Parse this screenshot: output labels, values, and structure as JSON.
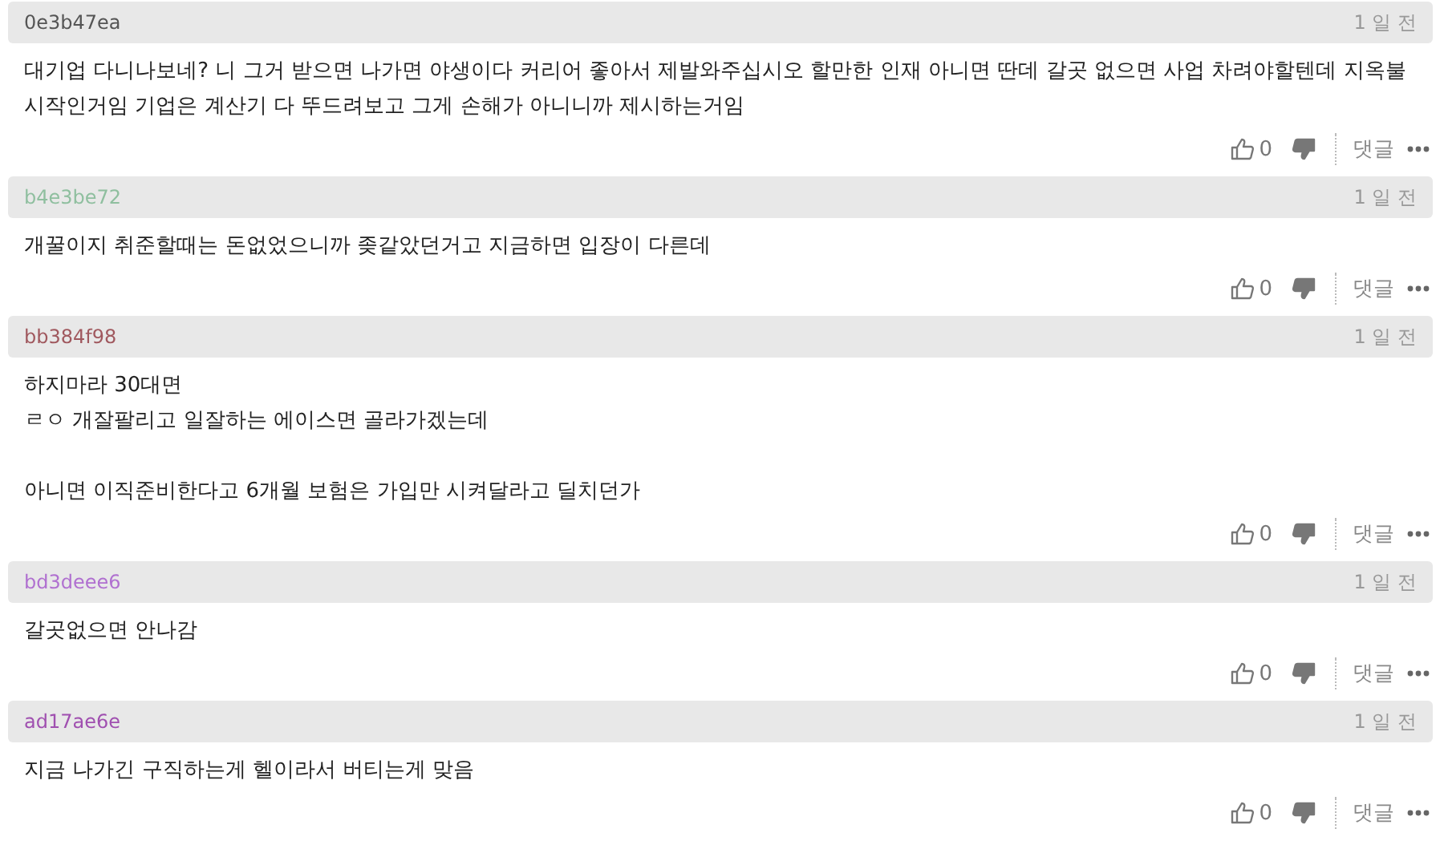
{
  "comments": [
    {
      "author": "0e3b47ea",
      "color": "#555555",
      "time": "1 일 전",
      "body": "대기업 다니나보네? 니 그거 받으면 나가면 야생이다 커리어 좋아서 제발와주십시오 할만한 인재 아니면 딴데 갈곳 없으면 사업 차려야할텐데 지옥불 시작인거임 기업은 계산기 다 뚜드려보고 그게 손해가 아니니까 제시하는거임",
      "likes": "0",
      "reply": "댓글"
    },
    {
      "author": "b4e3be72",
      "color": "#8fbf9f",
      "time": "1 일 전",
      "body": "개꿀이지 취준할때는 돈없었으니까 좆같았던거고 지금하면 입장이 다른데",
      "likes": "0",
      "reply": "댓글"
    },
    {
      "author": "bb384f98",
      "color": "#a0585e",
      "time": "1 일 전",
      "body": "하지마라 30대면\nㄹㅇ 개잘팔리고 일잘하는 에이스면 골라가겠는데\n\n아니면 이직준비한다고 6개월 보험은 가입만 시켜달라고 딜치던가",
      "likes": "0",
      "reply": "댓글"
    },
    {
      "author": "bd3deee6",
      "color": "#b070d0",
      "time": "1 일 전",
      "body": "갈곳없으면 안나감",
      "likes": "0",
      "reply": "댓글"
    },
    {
      "author": "ad17ae6e",
      "color": "#a050b0",
      "time": "1 일 전",
      "body": "지금 나가긴 구직하는게 헬이라서 버티는게 맞음",
      "likes": "0",
      "reply": "댓글"
    }
  ]
}
